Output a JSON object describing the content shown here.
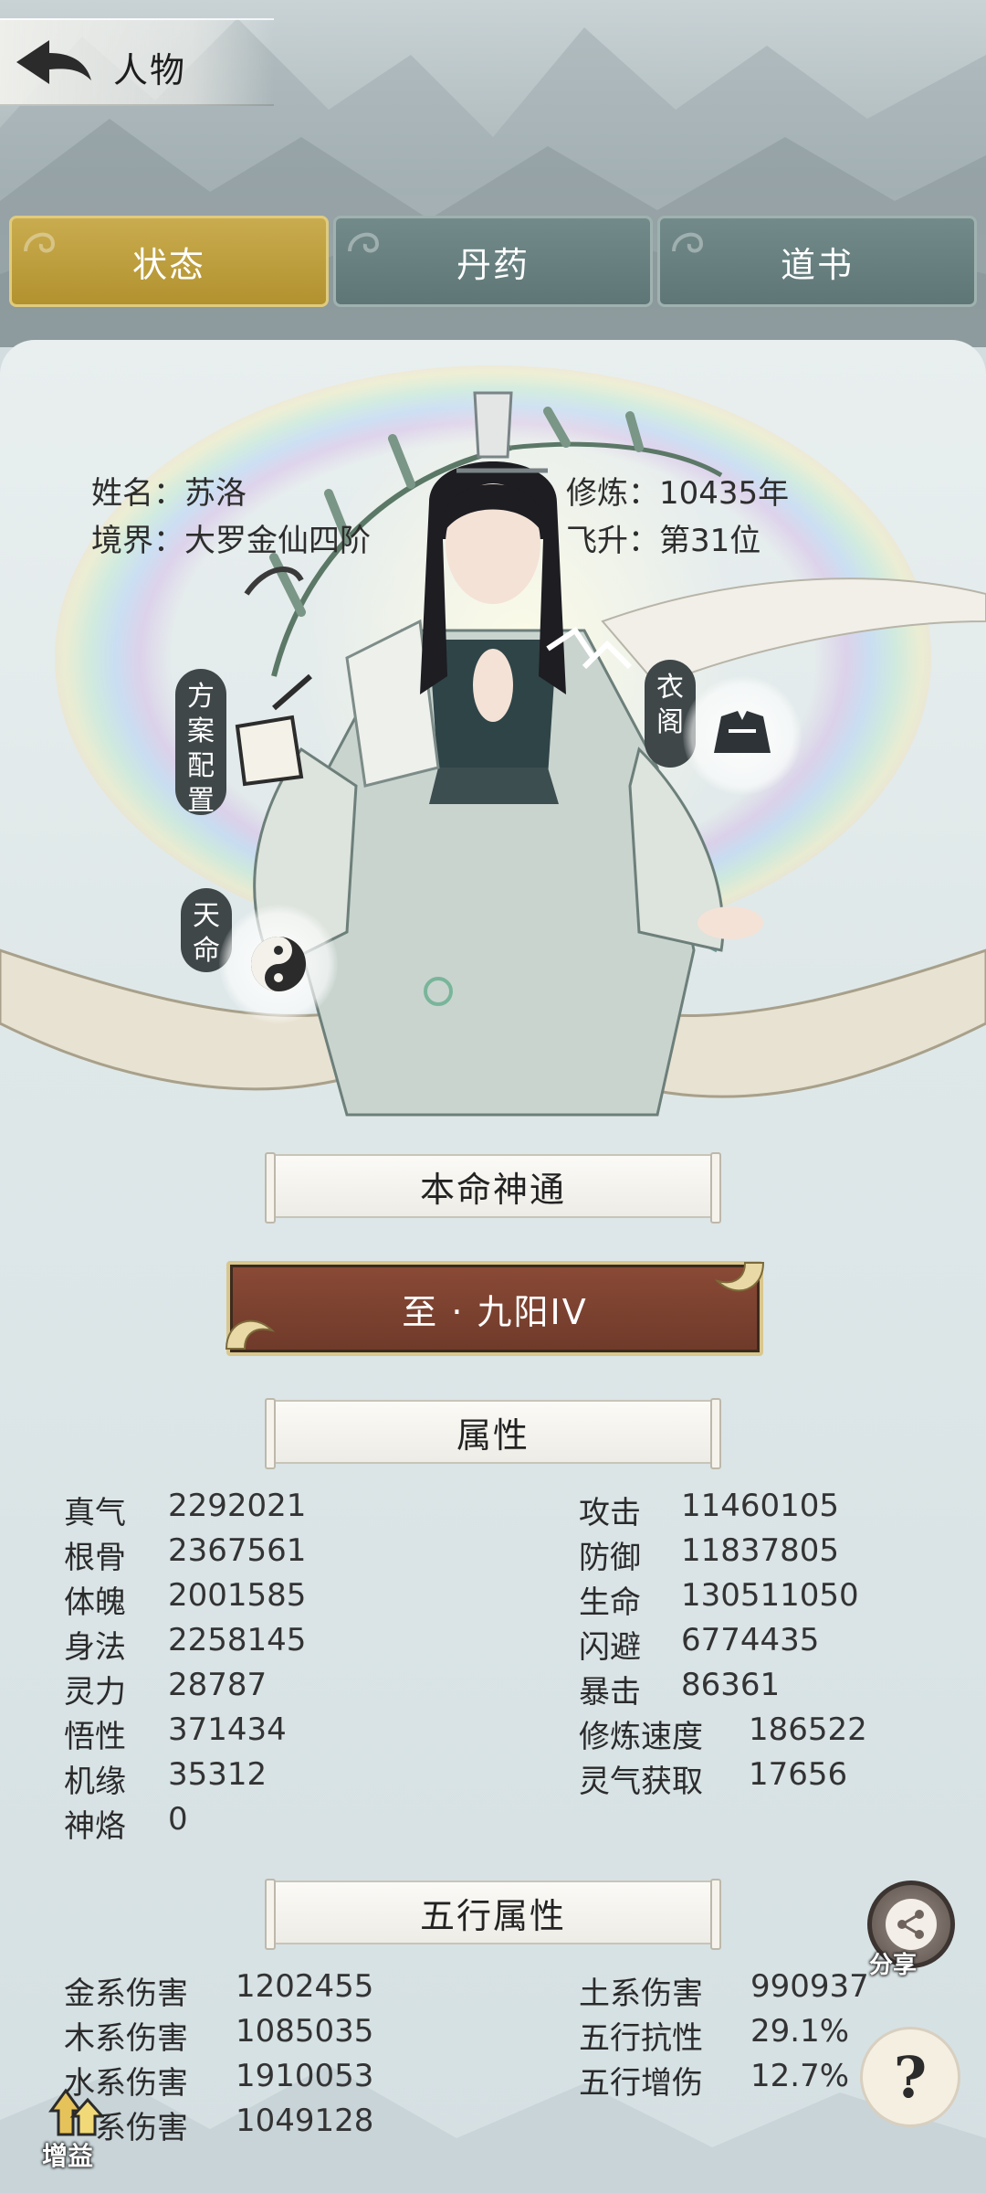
{
  "header": {
    "title": "人物"
  },
  "tabs": [
    {
      "label": "状态",
      "active": true
    },
    {
      "label": "丹药",
      "active": false
    },
    {
      "label": "道书",
      "active": false
    }
  ],
  "profile": {
    "name_label": "姓名：",
    "name": "苏洛",
    "cultivation_label": "修炼：",
    "cultivation": "10435年",
    "realm_label": "境界：",
    "realm": "大罗金仙四阶",
    "ascension_label": "飞升：",
    "ascension": "第31位"
  },
  "side_buttons": {
    "plan": "方案配置",
    "wardrobe": "衣阁",
    "destiny": "天命"
  },
  "sections": {
    "natal": "本命神通",
    "attributes": "属性",
    "five_elements": "五行属性"
  },
  "skill": {
    "label": "至 · 九阳IV"
  },
  "attributes_left": [
    {
      "name": "真气",
      "value": "2292021"
    },
    {
      "name": "根骨",
      "value": "2367561"
    },
    {
      "name": "体魄",
      "value": "2001585"
    },
    {
      "name": "身法",
      "value": "2258145"
    },
    {
      "name": "灵力",
      "value": "28787"
    },
    {
      "name": "悟性",
      "value": "371434"
    },
    {
      "name": "机缘",
      "value": "35312"
    },
    {
      "name": "神烙",
      "value": "0"
    }
  ],
  "attributes_right": [
    {
      "name": "攻击",
      "value": "11460105"
    },
    {
      "name": "防御",
      "value": "11837805"
    },
    {
      "name": "生命",
      "value": "130511050"
    },
    {
      "name": "闪避",
      "value": "6774435"
    },
    {
      "name": "暴击",
      "value": "86361"
    },
    {
      "name": "修炼速度",
      "value": "186522"
    },
    {
      "name": "灵气获取",
      "value": "17656"
    }
  ],
  "elements_left": [
    {
      "name": "金系伤害",
      "value": "1202455"
    },
    {
      "name": "木系伤害",
      "value": "1085035"
    },
    {
      "name": "水系伤害",
      "value": "1910053"
    },
    {
      "name": "系伤害",
      "value": "1049128"
    }
  ],
  "elements_right": [
    {
      "name": "土系伤害",
      "value": "990937"
    },
    {
      "name": "五行抗性",
      "value": "29.1%"
    },
    {
      "name": "五行增伤",
      "value": "12.7%"
    }
  ],
  "buttons": {
    "share": "分享",
    "boost": "增益",
    "help": "?"
  }
}
